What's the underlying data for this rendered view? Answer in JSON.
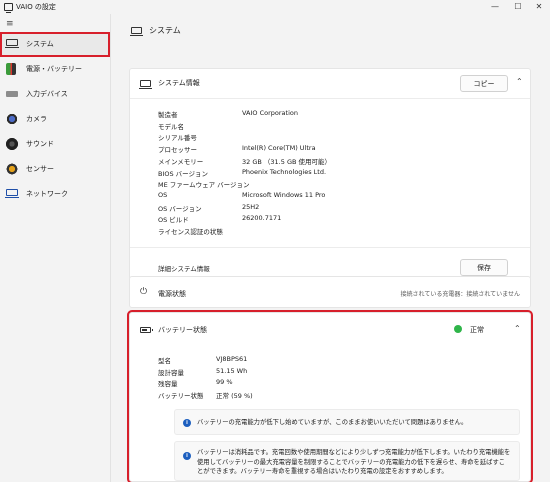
{
  "window": {
    "title": "VAIO の設定",
    "minimize": "—",
    "maximize": "☐",
    "close": "✕"
  },
  "sidebar": {
    "menu_icon": "≡",
    "items": [
      {
        "label": "システム",
        "icon": "laptop-icon",
        "active": true
      },
      {
        "label": "電源・バッテリー",
        "icon": "battery-icon"
      },
      {
        "label": "入力デバイス",
        "icon": "keyboard-icon"
      },
      {
        "label": "カメラ",
        "icon": "camera-icon"
      },
      {
        "label": "サウンド",
        "icon": "speaker-icon"
      },
      {
        "label": "センサー",
        "icon": "sensor-icon"
      },
      {
        "label": "ネットワーク",
        "icon": "network-icon"
      }
    ]
  },
  "page": {
    "title": "システム"
  },
  "system_info": {
    "title": "システム情報",
    "copy_label": "コピー",
    "rows": [
      {
        "key": "製造者",
        "value": "VAIO Corporation"
      },
      {
        "key": "モデル名",
        "value": ""
      },
      {
        "key": "シリアル番号",
        "value": ""
      },
      {
        "key": "プロセッサー",
        "value": "Intel(R) Core(TM) Ultra"
      },
      {
        "key": "メインメモリー",
        "value": "32 GB （31.5 GB 使用可能）"
      },
      {
        "key": "BIOS バージョン",
        "value": "Phoenix Technologies Ltd."
      },
      {
        "key": "ME ファームウェア バージョン",
        "value": ""
      },
      {
        "key": "OS",
        "value": "Microsoft Windows 11 Pro"
      },
      {
        "key": "OS バージョン",
        "value": "25H2"
      },
      {
        "key": "OS ビルド",
        "value": "26200.7171"
      },
      {
        "key": "ライセンス認証の状態",
        "value": ""
      }
    ],
    "detail_label": "詳細システム情報",
    "save_label": "保存"
  },
  "power_state": {
    "title": "電源状態",
    "status": "接続されている充電器：接続されていません"
  },
  "battery": {
    "title": "バッテリー状態",
    "status": "正常",
    "status_color": "#2fb54a",
    "rows": [
      {
        "key": "型名",
        "value": "VJ8BPS61"
      },
      {
        "key": "設計容量",
        "value": "51.15 Wh"
      },
      {
        "key": "残容量",
        "value": "99 %"
      },
      {
        "key": "バッテリー状態",
        "value": "正常 (59 %)"
      }
    ],
    "notice1": "バッテリーの充電能力が低下し始めていますが、このままお使いいただいて問題はありません。",
    "notice2": "バッテリーは消耗品です。充電回数や使用期間などにより少しずつ充電能力が低下します。いたわり充電機能を使用してバッテリーの最大充電容量を制限することでバッテリーの充電能力の低下を遅らせ、寿命を延ばすことができます。バッテリー寿命を重視する場合はいたわり充電の設定をおすすめします。"
  }
}
